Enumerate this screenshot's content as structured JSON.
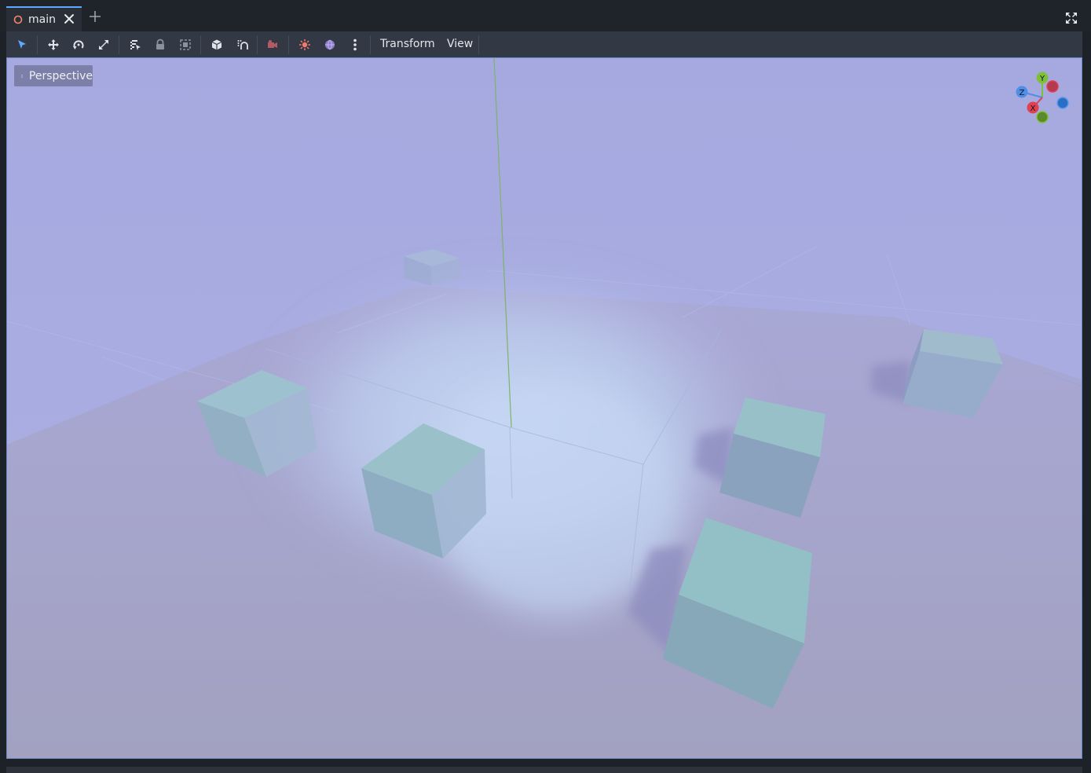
{
  "tabs": [
    {
      "label": "main",
      "icon": "scene-circle-icon",
      "icon_color": "#f08a6b"
    }
  ],
  "toolbar": {
    "menus": [
      {
        "label": "Transform"
      },
      {
        "label": "View"
      }
    ],
    "tools": [
      "select-mode-icon",
      "move-mode-icon",
      "rotate-mode-icon",
      "scale-mode-icon",
      "list-select-icon",
      "lock-icon",
      "group-icon",
      "local-space-icon",
      "snap-icon",
      "camera-preview-icon",
      "sun-icon",
      "environment-icon",
      "more-icon"
    ],
    "accent_color": "#5fa8ff"
  },
  "viewport": {
    "view_mode_label": "Perspective",
    "gizmo": {
      "y": "Y",
      "z": "Z",
      "x": "X"
    },
    "colors": {
      "sky": "#a8aadc",
      "floor": "#a2a2c2",
      "cube": "#8fbcc2",
      "fog": "#c4d6f2",
      "y_axis_line": "#7fb26a"
    }
  }
}
